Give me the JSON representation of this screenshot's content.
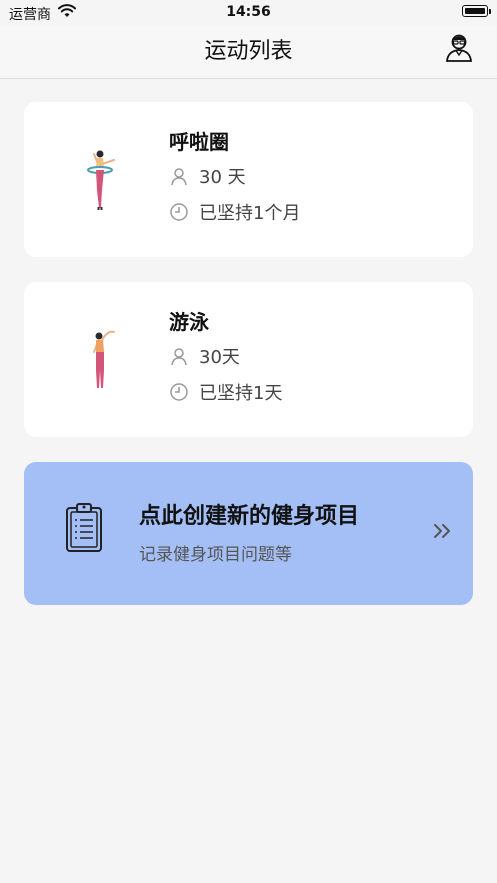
{
  "status_bar": {
    "carrier": "运营商",
    "time": "14:56"
  },
  "nav": {
    "title": "运动列表",
    "user_icon": "user-profile-icon"
  },
  "exercises": [
    {
      "name": "呼啦圈",
      "people": "30 天",
      "persisted": "已坚持1个月",
      "figure_icon": "hula-hoop-figure-icon"
    },
    {
      "name": "游泳",
      "people": "30天",
      "persisted": "已坚持1天",
      "figure_icon": "stretching-figure-icon"
    }
  ],
  "create": {
    "title": "点此创建新的健身项目",
    "subtitle": "记录健身项目问题等",
    "icon": "clipboard-icon",
    "arrow": "double-chevron-right-icon"
  },
  "colors": {
    "background": "#f5f5f5",
    "card": "#ffffff",
    "create_card": "#a4bff5",
    "text_primary": "#111111",
    "text_secondary": "#444444"
  }
}
